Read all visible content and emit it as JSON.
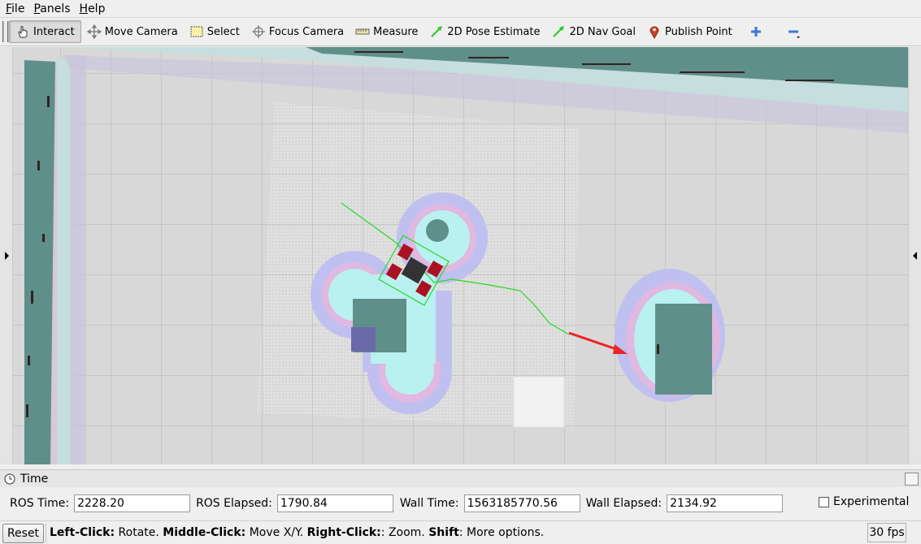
{
  "menu": [
    {
      "label": "File",
      "accel": "F",
      "rest": "ile"
    },
    {
      "label": "Panels",
      "accel": "P",
      "rest": "anels"
    },
    {
      "label": "Help",
      "accel": "H",
      "rest": "elp"
    }
  ],
  "toolbar": {
    "tools": [
      {
        "label": "Interact",
        "icon": "hand-icon",
        "active": true
      },
      {
        "label": "Move Camera",
        "icon": "move-camera-icon"
      },
      {
        "label": "Select",
        "icon": "select-icon"
      },
      {
        "label": "Focus Camera",
        "icon": "focus-camera-icon"
      },
      {
        "label": "Measure",
        "icon": "ruler-icon"
      },
      {
        "label": "2D Pose Estimate",
        "icon": "pose-arrow-icon"
      },
      {
        "label": "2D Nav Goal",
        "icon": "nav-goal-arrow-icon"
      },
      {
        "label": "Publish Point",
        "icon": "map-pin-icon"
      }
    ],
    "add_icon": "plus-icon",
    "remove_icon": "minus-icon"
  },
  "time_panel": {
    "title": "Time",
    "ros_time_label": "ROS Time:",
    "ros_time": "2228.20",
    "ros_elapsed_label": "ROS Elapsed:",
    "ros_elapsed": "1790.84",
    "wall_time_label": "Wall Time:",
    "wall_time": "1563185770.56",
    "wall_elapsed_label": "Wall Elapsed:",
    "wall_elapsed": "2134.92",
    "experimental_label": "Experimental",
    "experimental_checked": false
  },
  "status": {
    "reset_label": "Reset",
    "hint_parts": [
      {
        "text": "Left-Click:",
        "bold": true
      },
      {
        "text": " Rotate. ",
        "bold": false
      },
      {
        "text": "Middle-Click:",
        "bold": true
      },
      {
        "text": " Move X/Y. ",
        "bold": false
      },
      {
        "text": "Right-Click:",
        "bold": true
      },
      {
        "text": ": Zoom. ",
        "bold": false
      },
      {
        "text": "Shift",
        "bold": true
      },
      {
        "text": ": More options.",
        "bold": false
      }
    ],
    "fps": "30 fps"
  },
  "colors": {
    "grid": "#b4b4b4",
    "free_space": "#d8d8d8",
    "obstacle": "#5f8f8a",
    "inflation_cyan": "#b9f0f0",
    "inflation_purple": "#b8b8f0",
    "path": "#22dd22",
    "goal_arrow": "#ee2222",
    "robot_wheels": "#aa1122"
  }
}
